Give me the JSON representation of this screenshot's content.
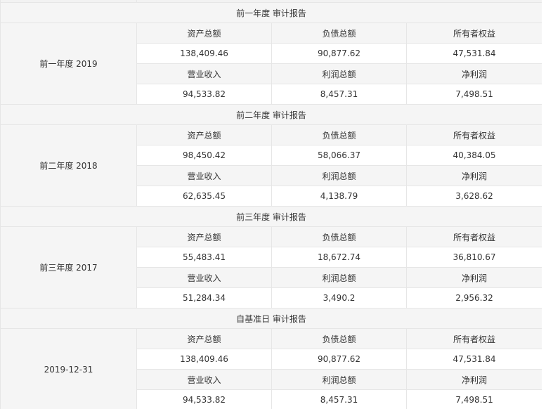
{
  "sections": [
    {
      "title": "前一年度 审计报告",
      "period": "前一年度 2019",
      "labels_row1": [
        "资产总额",
        "负债总额",
        "所有者权益"
      ],
      "values_row1": [
        "138,409.46",
        "90,877.62",
        "47,531.84"
      ],
      "labels_row2": [
        "营业收入",
        "利润总额",
        "净利润"
      ],
      "values_row2": [
        "94,533.82",
        "8,457.31",
        "7,498.51"
      ]
    },
    {
      "title": "前二年度 审计报告",
      "period": "前二年度 2018",
      "labels_row1": [
        "资产总额",
        "负债总额",
        "所有者权益"
      ],
      "values_row1": [
        "98,450.42",
        "58,066.37",
        "40,384.05"
      ],
      "labels_row2": [
        "营业收入",
        "利润总额",
        "净利润"
      ],
      "values_row2": [
        "62,635.45",
        "4,138.79",
        "3,628.62"
      ]
    },
    {
      "title": "前三年度 审计报告",
      "period": "前三年度 2017",
      "labels_row1": [
        "资产总额",
        "负债总额",
        "所有者权益"
      ],
      "values_row1": [
        "55,483.41",
        "18,672.74",
        "36,810.67"
      ],
      "labels_row2": [
        "营业收入",
        "利润总额",
        "净利润"
      ],
      "values_row2": [
        "51,284.34",
        "3,490.2",
        "2,956.32"
      ]
    },
    {
      "title": "自基准日 审计报告",
      "period": "2019-12-31",
      "labels_row1": [
        "资产总额",
        "负债总额",
        "所有者权益"
      ],
      "values_row1": [
        "138,409.46",
        "90,877.62",
        "47,531.84"
      ],
      "labels_row2": [
        "营业收入",
        "利润总额",
        "净利润"
      ],
      "values_row2": [
        "94,533.82",
        "8,457.31",
        "7,498.51"
      ]
    }
  ]
}
